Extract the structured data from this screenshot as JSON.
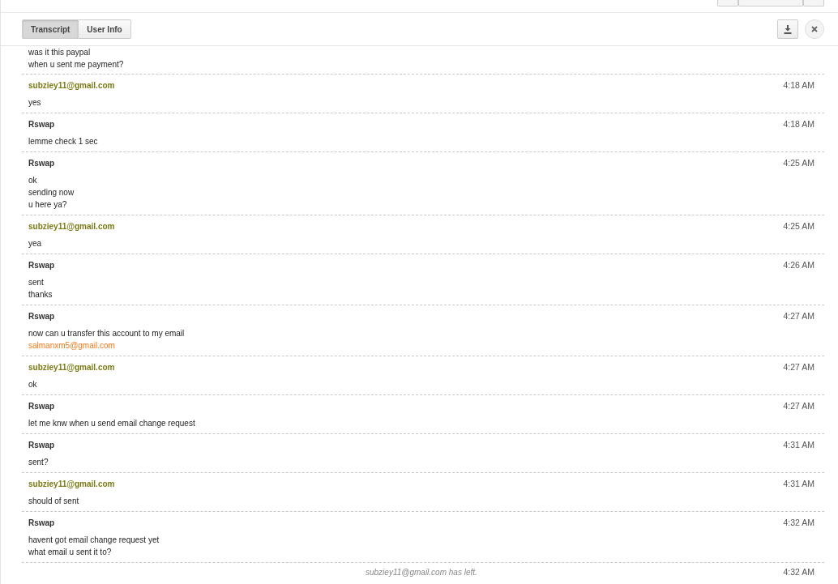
{
  "tabs": [
    {
      "label": "Transcript",
      "selected": true
    },
    {
      "label": "User Info",
      "selected": false
    }
  ],
  "partial_message": {
    "lines": [
      {
        "text": "was it this paypal",
        "link": false
      },
      {
        "text": "when u sent me payment?",
        "link": false
      }
    ]
  },
  "messages": [
    {
      "sender": "subziey11@gmail.com",
      "kind": "visitor",
      "time": "4:18 AM",
      "lines": [
        {
          "text": "yes",
          "link": false
        }
      ]
    },
    {
      "sender": "Rswap",
      "kind": "agent",
      "time": "4:18 AM",
      "lines": [
        {
          "text": "lemme check 1 sec",
          "link": false
        }
      ]
    },
    {
      "sender": "Rswap",
      "kind": "agent",
      "time": "4:25 AM",
      "lines": [
        {
          "text": "ok",
          "link": false
        },
        {
          "text": "sending now",
          "link": false
        },
        {
          "text": "u here ya?",
          "link": false
        }
      ]
    },
    {
      "sender": "subziey11@gmail.com",
      "kind": "visitor",
      "time": "4:25 AM",
      "lines": [
        {
          "text": "yea",
          "link": false
        }
      ]
    },
    {
      "sender": "Rswap",
      "kind": "agent",
      "time": "4:26 AM",
      "lines": [
        {
          "text": "sent",
          "link": false
        },
        {
          "text": "thanks",
          "link": false
        }
      ]
    },
    {
      "sender": "Rswap",
      "kind": "agent",
      "time": "4:27 AM",
      "lines": [
        {
          "text": "now can u transfer this account to my email",
          "link": false
        },
        {
          "text": "salmanxm5@gmail.com",
          "link": true
        }
      ]
    },
    {
      "sender": "subziey11@gmail.com",
      "kind": "visitor",
      "time": "4:27 AM",
      "lines": [
        {
          "text": "ok",
          "link": false
        }
      ]
    },
    {
      "sender": "Rswap",
      "kind": "agent",
      "time": "4:27 AM",
      "lines": [
        {
          "text": "let me knw when u send email change request",
          "link": false
        }
      ]
    },
    {
      "sender": "Rswap",
      "kind": "agent",
      "time": "4:31 AM",
      "lines": [
        {
          "text": "sent?",
          "link": false
        }
      ]
    },
    {
      "sender": "subziey11@gmail.com",
      "kind": "visitor",
      "time": "4:31 AM",
      "lines": [
        {
          "text": "should of sent",
          "link": false
        }
      ]
    },
    {
      "sender": "Rswap",
      "kind": "agent",
      "time": "4:32 AM",
      "lines": [
        {
          "text": "havent got email change request yet",
          "link": false
        },
        {
          "text": "what email u sent it to?",
          "link": false
        }
      ]
    }
  ],
  "status_event": {
    "text": "subziey11@gmail.com has left.",
    "time": "4:32 AM"
  }
}
